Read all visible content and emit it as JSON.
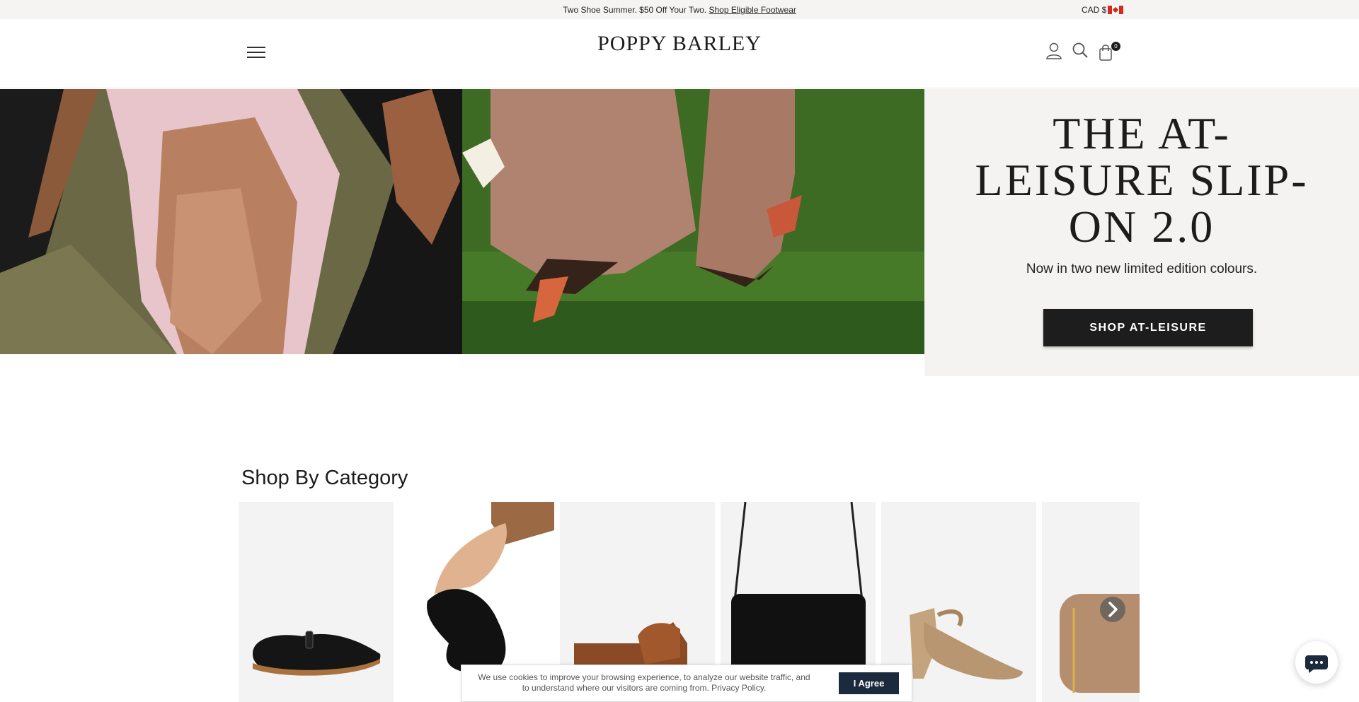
{
  "announcement": {
    "text": "Two Shoe Summer. $50 Off Your Two. ",
    "link": "Shop Eligible Footwear",
    "currency": "CAD $"
  },
  "header": {
    "logo": "POPPY BARLEY",
    "cart_count": "0"
  },
  "hero": {
    "title": "THE AT-LEISURE SLIP-ON 2.0",
    "subtitle": "Now in two new limited edition colours.",
    "cta": "SHOP AT-LEISURE"
  },
  "categories": {
    "heading": "Shop By Category",
    "items": [
      {
        "icon": "mary-jane-shoe"
      },
      {
        "icon": "foldable-flat"
      },
      {
        "icon": "mule"
      },
      {
        "icon": "crossbody-bag"
      },
      {
        "icon": "heeled-sandal"
      },
      {
        "icon": "pouch"
      }
    ]
  },
  "cookie": {
    "text": "We use cookies to improve your browsing experience, to analyze our website traffic, and to understand where our visitors are coming from. Privacy Policy.",
    "button": "I Agree"
  },
  "colors": {
    "accent_dark": "#1d1d1d",
    "cookie_button": "#1c2a3d",
    "panel_bg": "#f4f3f1"
  }
}
